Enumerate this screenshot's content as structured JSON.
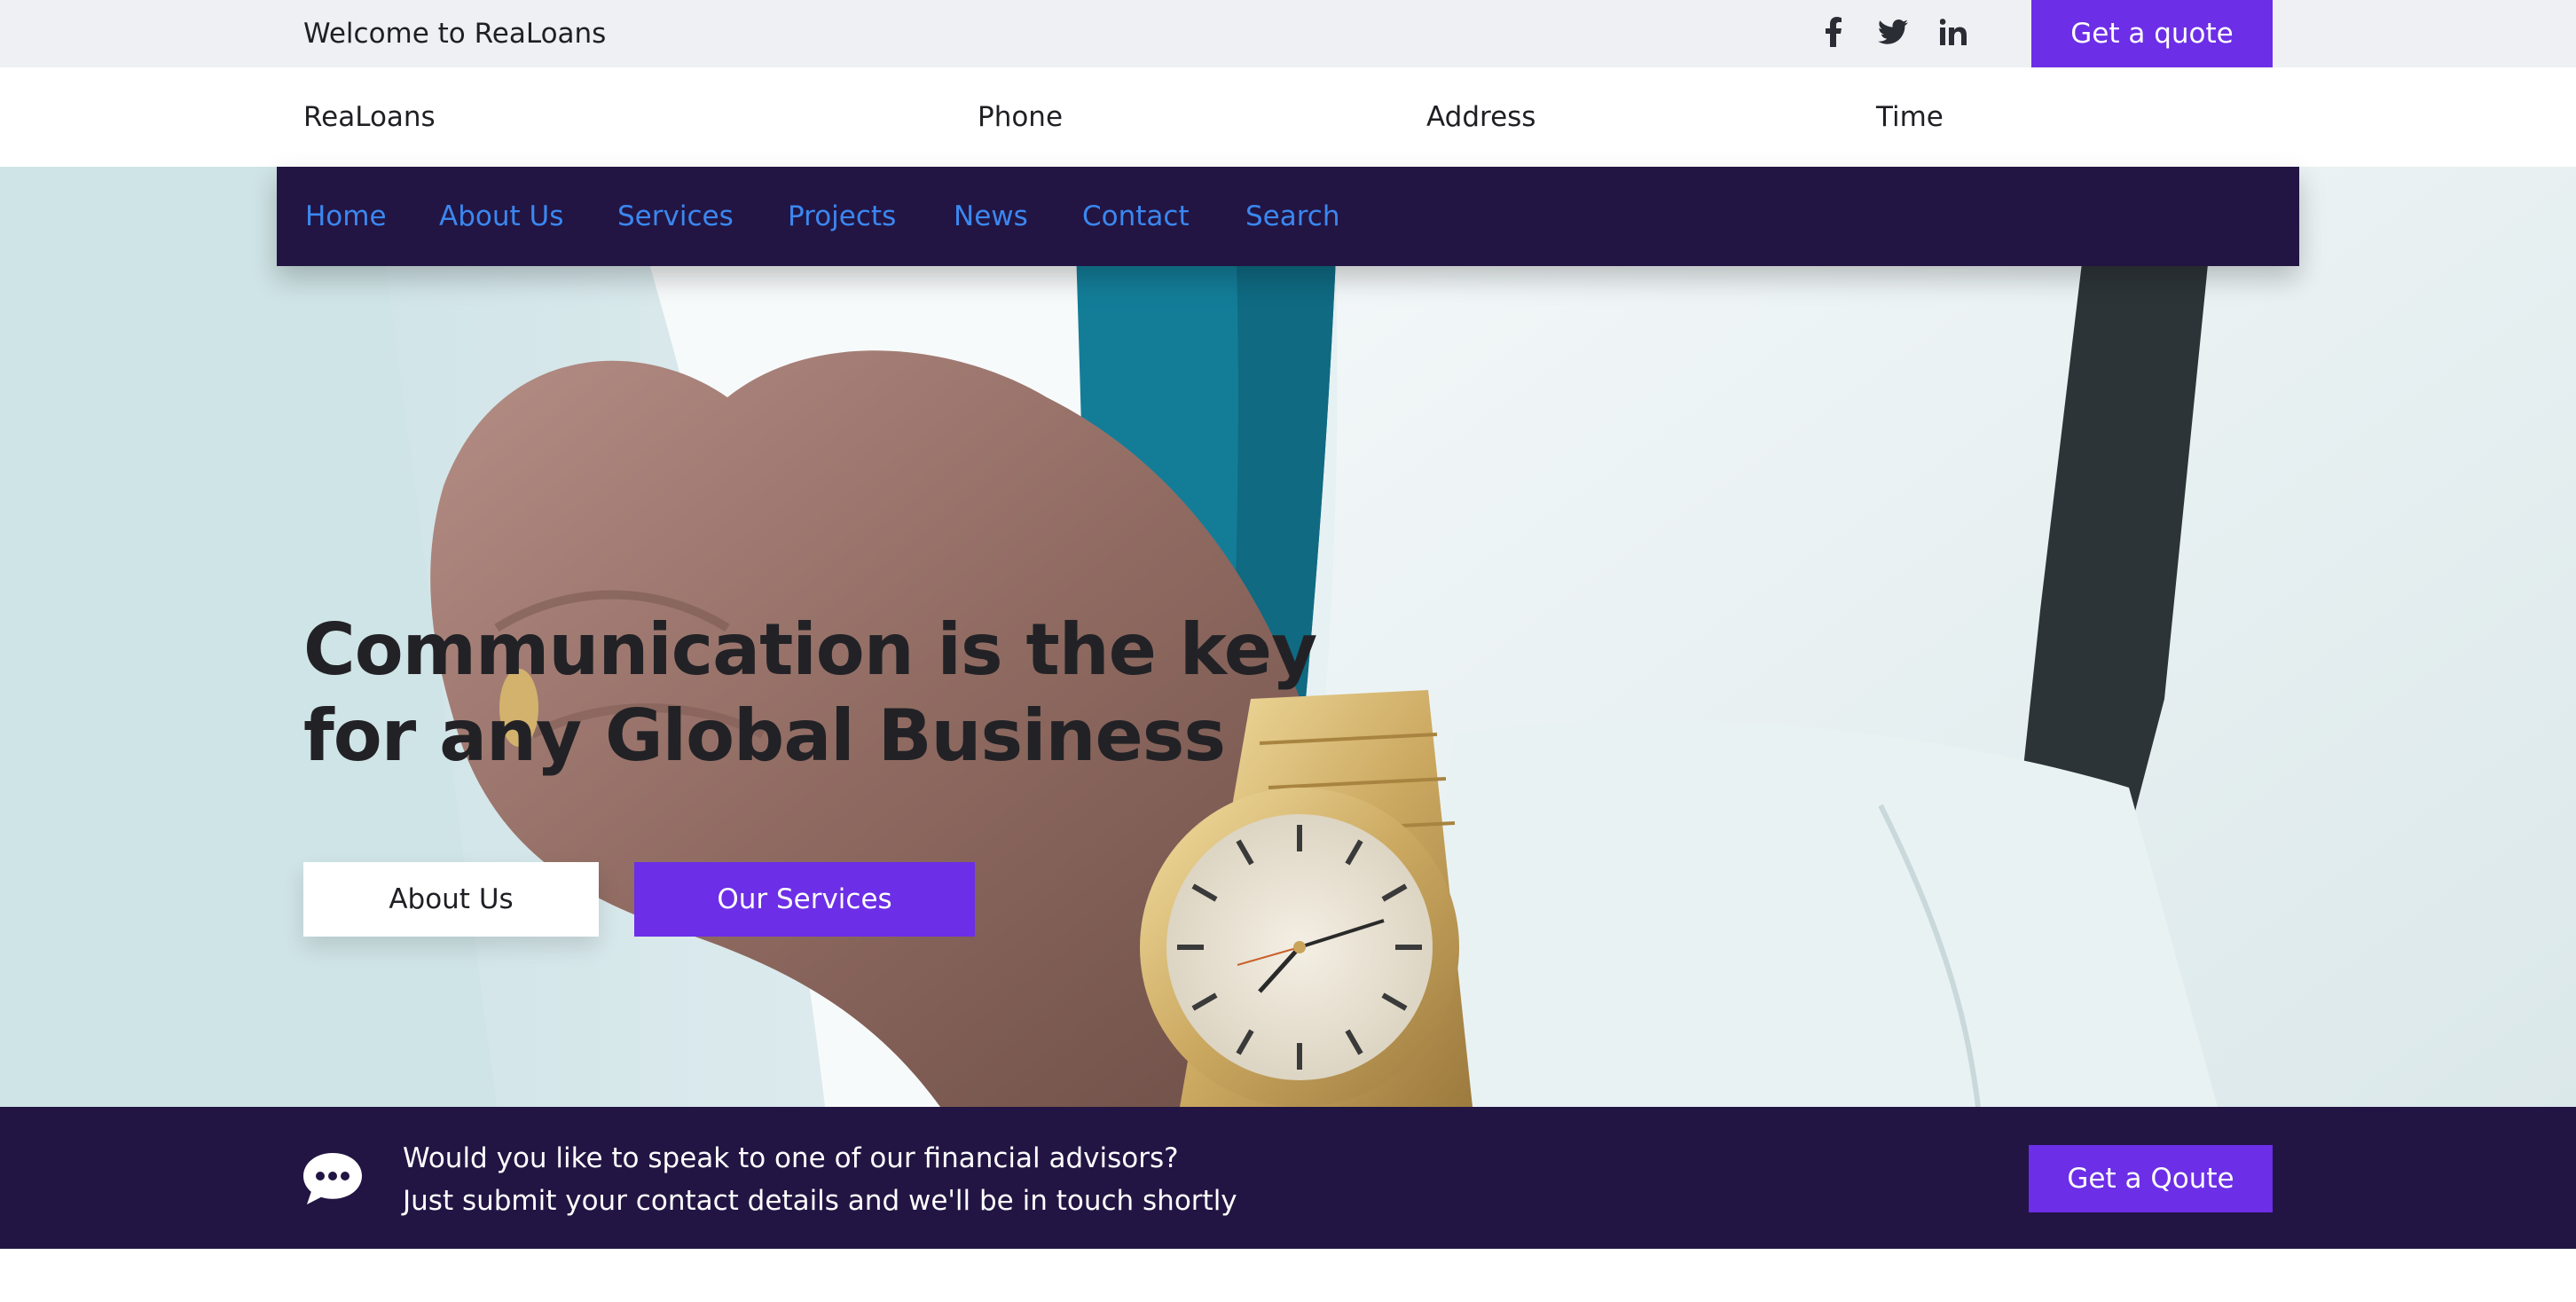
{
  "topbar": {
    "welcome": "Welcome to ReaLoans",
    "social": [
      "facebook-icon",
      "twitter-icon",
      "linkedin-icon"
    ],
    "quote_label": "Get a quote"
  },
  "info": {
    "brand": "ReaLoans",
    "phone": "Phone",
    "address": "Address",
    "time": "Time"
  },
  "nav": {
    "items": [
      {
        "label": "Home"
      },
      {
        "label": "About Us"
      },
      {
        "label": "Services"
      },
      {
        "label": "Projects"
      },
      {
        "label": "News"
      },
      {
        "label": "Contact"
      },
      {
        "label": "Search"
      }
    ]
  },
  "hero": {
    "headline_line1": "Communication is the key",
    "headline_line2": "for any Global Business",
    "about_label": "About Us",
    "services_label": "Our Services"
  },
  "cta": {
    "icon": "chat-bubble-icon",
    "line1": "Would you like to speak to one of our financial advisors?",
    "line2": "Just submit your contact details and we'll be in touch shortly",
    "button_label": "Get a Qoute"
  },
  "colors": {
    "accent": "#6c2ee6",
    "dark_navy": "#221543",
    "nav_link": "#3b87f0",
    "topbar_bg": "#eef0f4"
  }
}
